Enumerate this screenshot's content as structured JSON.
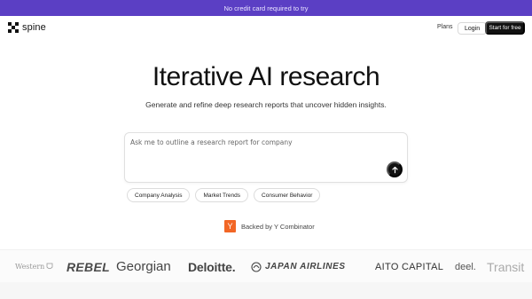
{
  "banner": {
    "text": "No credit card required to try",
    "bg": "#5b3fc4"
  },
  "nav": {
    "logo_text": "spine",
    "plans_label": "Plans",
    "login_label": "Login",
    "start_label": "Start for free"
  },
  "hero": {
    "title": "Iterative AI research",
    "subtitle": "Generate and refine deep research reports that uncover hidden insights."
  },
  "prompt": {
    "placeholder": "Ask me to outline a research report for company",
    "send_icon": "arrow-up-icon"
  },
  "chips": [
    {
      "label": "Company Analysis"
    },
    {
      "label": "Market Trends"
    },
    {
      "label": "Consumer Behavior"
    }
  ],
  "backing": {
    "badge": "Y",
    "text": "Backed by Y Combinator",
    "badge_color": "#f26625"
  },
  "brands": [
    {
      "name": "Western"
    },
    {
      "name": "REBEL"
    },
    {
      "name": "Georgian"
    },
    {
      "name": "Deloitte."
    },
    {
      "name": "JAPAN AIRLINES"
    },
    {
      "name": "AITO CAPITAL"
    },
    {
      "name": "deel."
    },
    {
      "name": "Transit"
    }
  ]
}
